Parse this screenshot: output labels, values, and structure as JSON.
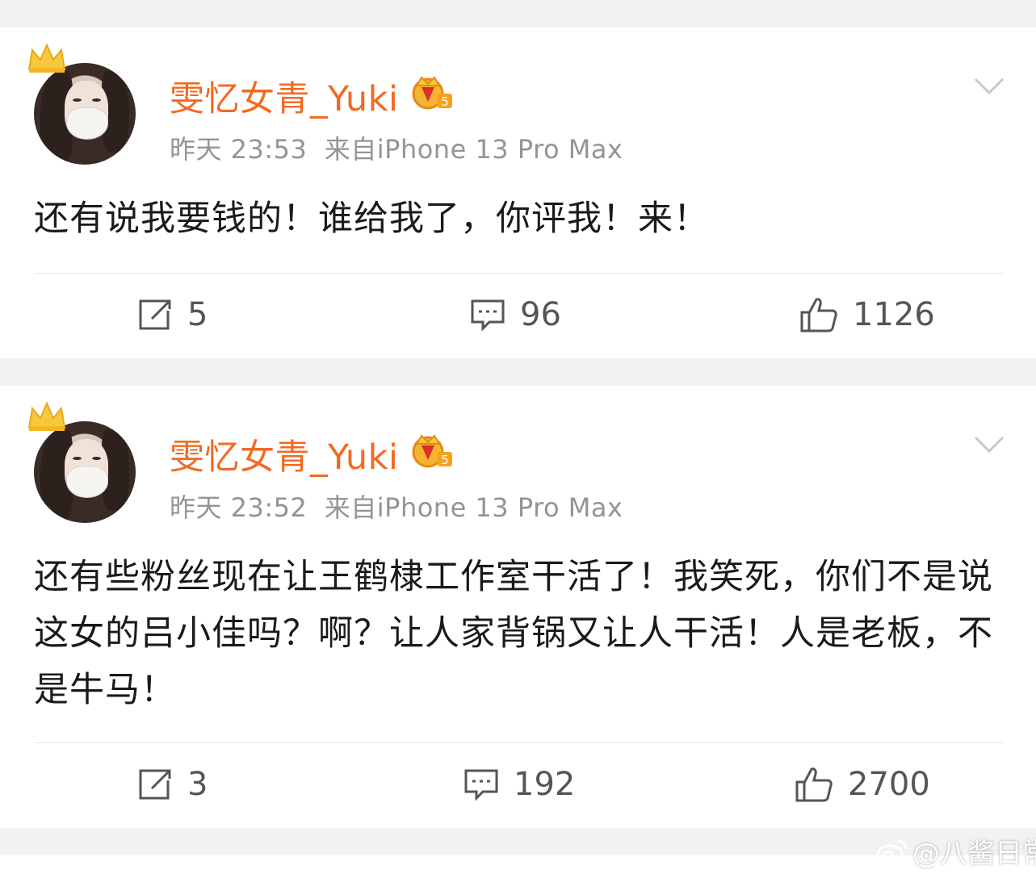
{
  "posts": [
    {
      "username": "雯忆女青_Yuki",
      "time": "昨天 23:53",
      "source": "来自iPhone 13 Pro Max",
      "content": "还有说我要钱的！谁给我了，你评我！来！",
      "reposts": "5",
      "comments": "96",
      "likes": "1126"
    },
    {
      "username": "雯忆女青_Yuki",
      "time": "昨天 23:52",
      "source": "来自iPhone 13 Pro Max",
      "content": "还有些粉丝现在让王鹤棣工作室干活了！我笑死，你们不是说这女的吕小佳吗？啊？让人家背锅又让人干活！人是老板，不是牛马！",
      "reposts": "3",
      "comments": "192",
      "likes": "2700"
    }
  ],
  "watermark": "@八酱日常",
  "colors": {
    "username": "#f26a21",
    "meta": "#949494",
    "background": "#f2f2f2",
    "card": "#ffffff"
  }
}
